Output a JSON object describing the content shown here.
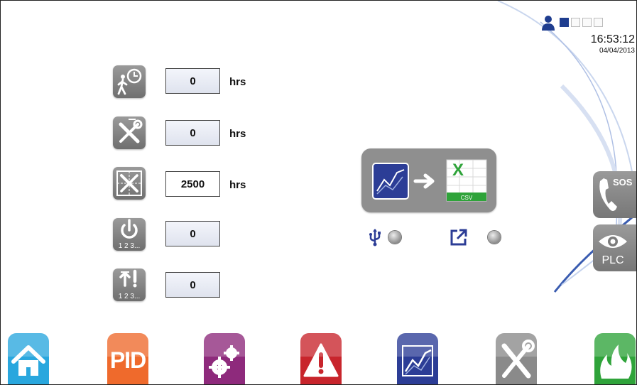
{
  "status": {
    "time": "16:53:12",
    "date": "04/04/2013",
    "user_icon": "user-icon",
    "level_indicators": [
      true,
      false,
      false,
      false
    ]
  },
  "counters": [
    {
      "icon": "running-timer-icon",
      "value": "0",
      "unit": "hrs"
    },
    {
      "icon": "maintenance-tools-icon",
      "value": "0",
      "unit": "hrs"
    },
    {
      "icon": "service-interval-icon",
      "value": "2500",
      "unit": "hrs"
    },
    {
      "icon": "power-cycle-count-icon",
      "value": "0",
      "unit": ""
    },
    {
      "icon": "alarm-count-icon",
      "value": "0",
      "unit": ""
    }
  ],
  "counter_icon_text": {
    "numbering": "1 2 3..."
  },
  "export": {
    "chart_icon": "trend-chart-icon",
    "arrow_icon": "arrow-right-icon",
    "csv_icon": "excel-csv-icon",
    "csv_label": "CSV",
    "usb_icon": "usb-icon",
    "external_icon": "external-export-icon"
  },
  "side": {
    "sos_label": "SOS",
    "plc_label": "PLC"
  },
  "nav": [
    {
      "name": "home",
      "icon": "home-icon",
      "color": "#29a7de"
    },
    {
      "name": "pid",
      "label": "PID",
      "color": "#ef6a2c"
    },
    {
      "name": "settings",
      "icon": "gears-icon",
      "color": "#8e2a7c"
    },
    {
      "name": "alarms",
      "icon": "warning-icon",
      "color": "#c8252c"
    },
    {
      "name": "trends",
      "icon": "trend-chart-icon",
      "color": "#2c3d96"
    },
    {
      "name": "maintenance",
      "icon": "tools-icon",
      "color": "#8a8a8a"
    },
    {
      "name": "burner",
      "icon": "flame-icon",
      "color": "#2fa33a"
    }
  ]
}
